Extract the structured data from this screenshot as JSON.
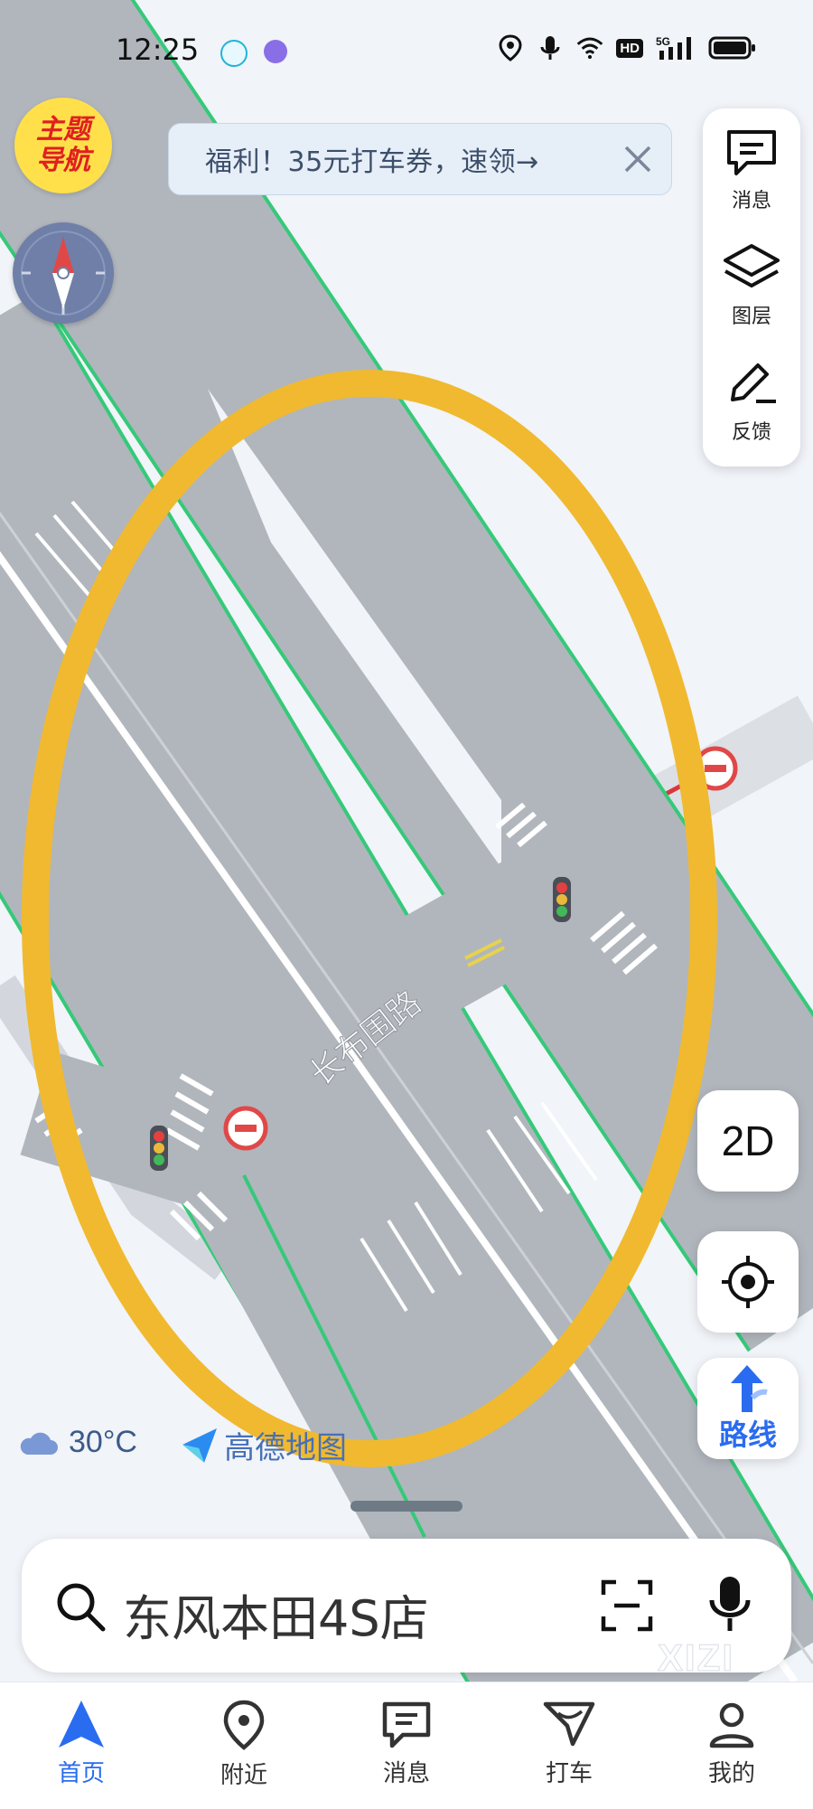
{
  "status_bar": {
    "time": "12:25",
    "network": "5G"
  },
  "theme_badge": {
    "label": "主题导航"
  },
  "promo_banner": {
    "text": "福利！35元打车券，速领→"
  },
  "side_panel": [
    {
      "label": "消息",
      "icon": "message-icon"
    },
    {
      "label": "图层",
      "icon": "layers-icon"
    },
    {
      "label": "反馈",
      "icon": "edit-icon"
    }
  ],
  "map": {
    "road_label": "长布围路",
    "highlight_color": "#f0b92f",
    "road_color": "#b1b6bd",
    "road_edge_color": "#35c979"
  },
  "controls": {
    "view_mode": "2D",
    "route_label": "路线"
  },
  "weather": {
    "temperature": "30°C",
    "icon": "cloud-icon"
  },
  "brand": {
    "name": "高德地图"
  },
  "search": {
    "value": "东风本田4S店"
  },
  "tabs": [
    {
      "label": "首页",
      "icon": "navigation-arrow-icon",
      "active": true
    },
    {
      "label": "附近",
      "icon": "location-pin-icon",
      "active": false
    },
    {
      "label": "消息",
      "icon": "message-icon",
      "active": false
    },
    {
      "label": "打车",
      "icon": "taxi-icon",
      "active": false
    },
    {
      "label": "我的",
      "icon": "user-icon",
      "active": false
    }
  ],
  "watermark": "XIZI",
  "colors": {
    "accent": "#2a6cf0",
    "highlight": "#f0b92f"
  }
}
